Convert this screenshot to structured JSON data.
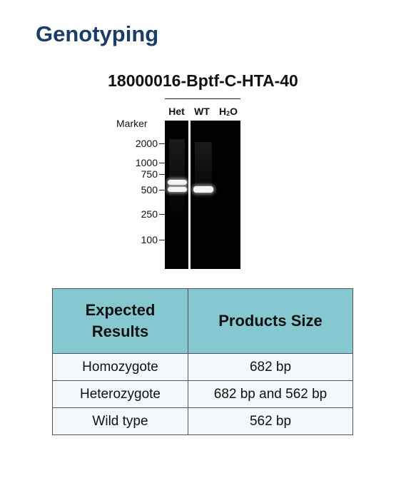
{
  "page_title": "Genotyping",
  "gel": {
    "title": "18000016-Bptf-C-HTA-40",
    "lanes": [
      "Het",
      "WT",
      "H",
      "2",
      "O"
    ],
    "marker_label": "Marker",
    "ladder": [
      "2000",
      "1000",
      "750",
      "500",
      "250",
      "100"
    ]
  },
  "table": {
    "headers": [
      "Expected Results",
      "Products Size"
    ],
    "rows": [
      [
        "Homozygote",
        "682 bp"
      ],
      [
        "Heterozygote",
        "682 bp and 562 bp"
      ],
      [
        "Wild type",
        "562 bp"
      ]
    ]
  }
}
